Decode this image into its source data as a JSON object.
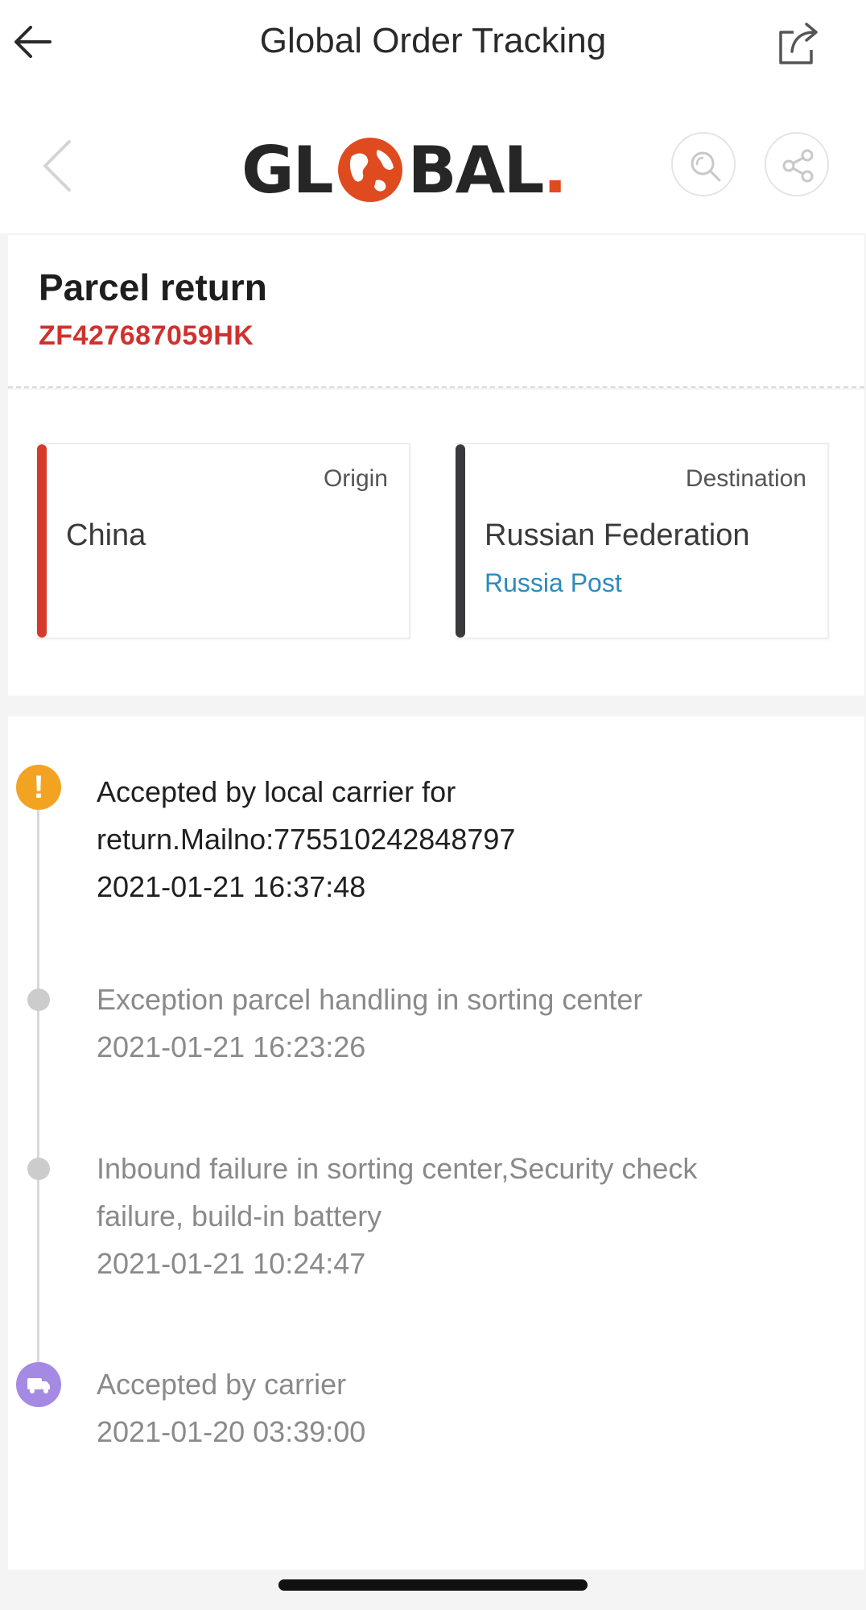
{
  "app_bar": {
    "title": "Global Order Tracking",
    "back_icon": "arrow-left-icon",
    "share_icon": "share-external-icon"
  },
  "web_header": {
    "back_icon": "chevron-left-icon",
    "logo": {
      "prefix": "GL",
      "suffix": "BAL",
      "dot": ".",
      "globe_icon": "globe-icon",
      "accent_color": "#e04a1f"
    },
    "search_icon": "search-icon",
    "share_icon": "share-nodes-icon"
  },
  "parcel": {
    "status": "Parcel return",
    "tracking_number": "ZF427687059HK",
    "tracking_color": "#d0312d"
  },
  "route": {
    "origin": {
      "caption": "Origin",
      "country": "China",
      "bar_color": "#d63a2a"
    },
    "destination": {
      "caption": "Destination",
      "country": "Russian Federation",
      "carrier": "Russia Post",
      "bar_color": "#3a3a3c"
    }
  },
  "events": [
    {
      "line1": "Accepted by local carrier for",
      "line2": "return.Mailno:775510242848797",
      "time": "2021-01-21 16:37:48",
      "icon": "exclamation-icon",
      "active": true
    },
    {
      "line1": "Exception parcel handling in sorting center",
      "line2": "",
      "time": "2021-01-21 16:23:26",
      "icon": "dot-icon",
      "active": false
    },
    {
      "line1": "Inbound failure in sorting center,Security check",
      "line2": "failure, build-in battery",
      "time": "2021-01-21 10:24:47",
      "icon": "dot-icon",
      "active": false
    },
    {
      "line1": "Accepted by carrier",
      "line2": "",
      "time": "2021-01-20 03:39:00",
      "icon": "truck-icon",
      "active": false
    }
  ],
  "colors": {
    "warning": "#f2a321",
    "carrier_node": "#a58ae3",
    "link": "#2c8ac0"
  }
}
